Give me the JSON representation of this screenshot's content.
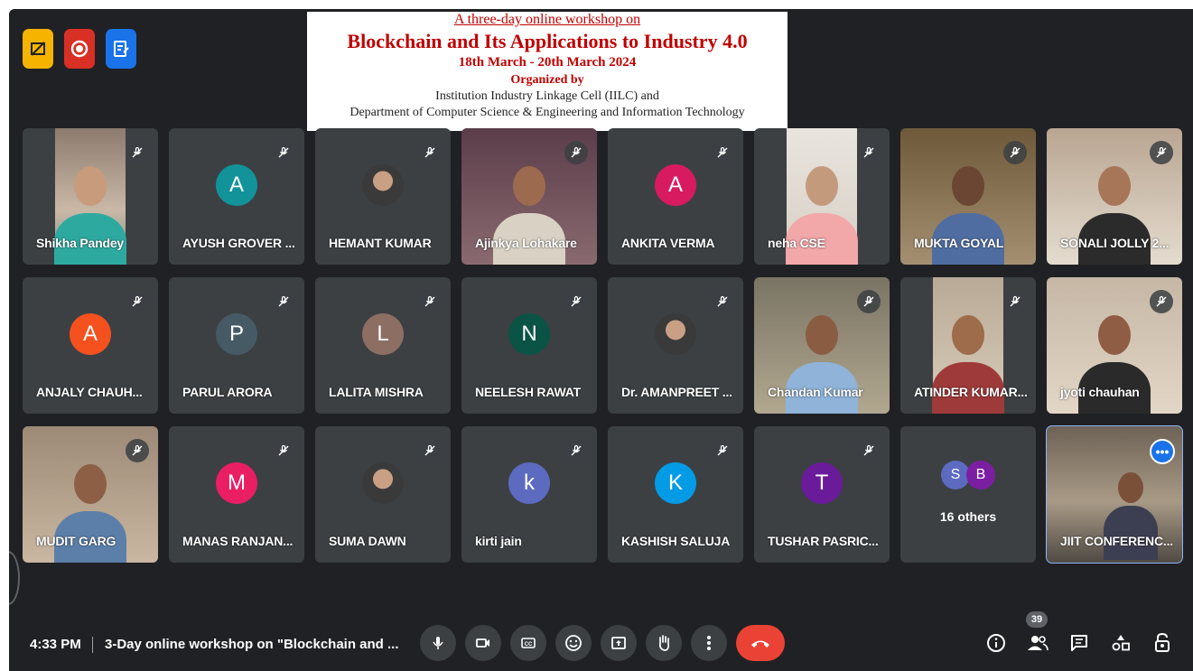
{
  "banner": {
    "line1": "A three-day online workshop on",
    "line2": "Blockchain and Its Applications to Industry 4.0",
    "line3": "18th March - 20th March 2024",
    "line4": "Organized by",
    "line5": "Institution Industry Linkage Cell (IILC) and",
    "line6": "Department of Computer Science & Engineering and Information Technology"
  },
  "participants": [
    {
      "name": "Shikha Pandey",
      "type": "video"
    },
    {
      "name": "AYUSH GROVER ...",
      "type": "initial",
      "initial": "A",
      "color": "#12939a"
    },
    {
      "name": "HEMANT KUMAR",
      "type": "photo-avatar"
    },
    {
      "name": "Ajinkya Lohakare",
      "type": "video"
    },
    {
      "name": "ANKITA VERMA",
      "type": "initial",
      "initial": "A",
      "color": "#d81b60"
    },
    {
      "name": "neha CSE",
      "type": "video"
    },
    {
      "name": "MUKTA GOYAL",
      "type": "video"
    },
    {
      "name": "SONALI JOLLY 2...",
      "type": "video"
    },
    {
      "name": "ANJALY CHAUH...",
      "type": "initial",
      "initial": "A",
      "color": "#f4511e"
    },
    {
      "name": "PARUL ARORA",
      "type": "initial",
      "initial": "P",
      "color": "#455a64"
    },
    {
      "name": "LALITA MISHRA",
      "type": "initial",
      "initial": "L",
      "color": "#8d6e63"
    },
    {
      "name": "NEELESH RAWAT",
      "type": "initial",
      "initial": "N",
      "color": "#0b5345"
    },
    {
      "name": "Dr. AMANPREET ...",
      "type": "photo-avatar"
    },
    {
      "name": "Chandan Kumar",
      "type": "video"
    },
    {
      "name": "ATINDER KUMAR...",
      "type": "video"
    },
    {
      "name": "jyoti chauhan",
      "type": "video"
    },
    {
      "name": "MUDIT GARG",
      "type": "video"
    },
    {
      "name": "MANAS RANJAN...",
      "type": "initial",
      "initial": "M",
      "color": "#e91e63"
    },
    {
      "name": "SUMA DAWN",
      "type": "photo-avatar"
    },
    {
      "name": "kirti jain",
      "type": "initial",
      "initial": "k",
      "color": "#5c6bc0"
    },
    {
      "name": "KASHISH SALUJA",
      "type": "initial",
      "initial": "K",
      "color": "#039be5"
    },
    {
      "name": "TUSHAR PASRIC...",
      "type": "initial",
      "initial": "T",
      "color": "#6a1b9a"
    }
  ],
  "others": {
    "initial1": "S",
    "color1": "#5c6bc0",
    "initial2": "B",
    "color2": "#7b1fa2",
    "label": "16 others"
  },
  "self_tile": {
    "name": "JIIT CONFERENC...",
    "more": "•••"
  },
  "bottom_bar": {
    "time": "4:33 PM",
    "meeting_title": "3-Day online workshop on \"Blockchain and ...",
    "people_count": "39",
    "controls": [
      "mic-icon",
      "camera-icon",
      "captions-icon",
      "emoji-icon",
      "present-icon",
      "raise-hand-icon",
      "more-options-icon",
      "end-call-icon"
    ],
    "right_icons": [
      "info-icon",
      "people-icon",
      "chat-icon",
      "activities-icon",
      "host-controls-icon"
    ]
  },
  "colors": {
    "background": "#202124",
    "tile": "#3c4043",
    "accent": "#1a73e8",
    "end_call": "#ea4335"
  }
}
